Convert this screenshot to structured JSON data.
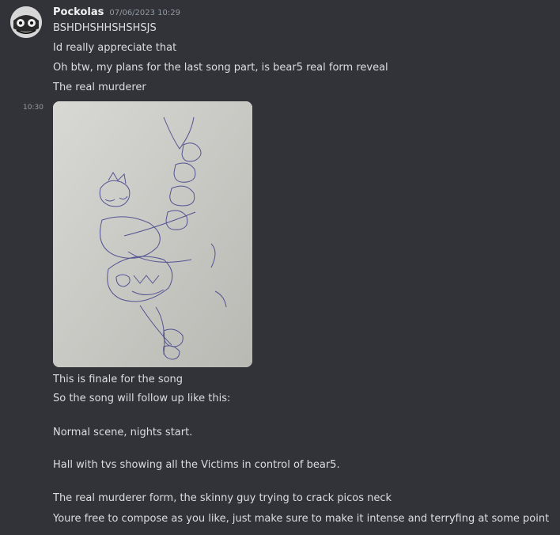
{
  "message": {
    "author": "Pockolas",
    "timestamp": "07/06/2023 10:29",
    "side_time": "10:30",
    "lines_top": [
      "BSHDHSHHSHSHSJS",
      "Id really appreciate that",
      "Oh btw, my plans for the last song part, is bear5 real form reveal",
      "The real murderer"
    ],
    "lines_bottom": [
      "This is finale for the song",
      "So the song will follow up like this:",
      "Normal scene, nights start.",
      "Hall with tvs showing all the Victims in control of bear5.",
      "The real murderer form, the skinny guy trying to crack picos neck",
      "Youre free to compose as you like, just make sure to make it intense and terryfing at some point"
    ]
  },
  "colors": {
    "background": "#313338",
    "text": "#dbdee1",
    "muted": "#949ba4",
    "name": "#f2f3f5"
  }
}
